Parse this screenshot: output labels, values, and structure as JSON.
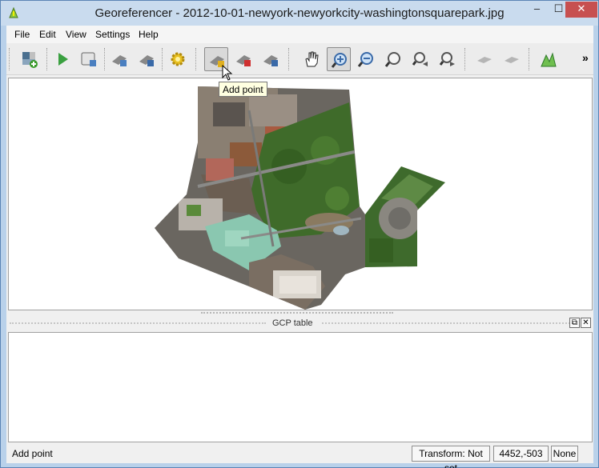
{
  "window": {
    "title": "Georeferencer - 2012-10-01-newyork-newyorkcity-washingtonsquarepark.jpg",
    "app_icon": "qgis-logo-icon",
    "minimize": "–",
    "maximize": "☐",
    "close": "✕"
  },
  "menubar": {
    "items": [
      {
        "label": "File"
      },
      {
        "label": "Edit"
      },
      {
        "label": "View"
      },
      {
        "label": "Settings"
      },
      {
        "label": "Help"
      }
    ]
  },
  "toolbar": {
    "buttons": [
      {
        "name": "open-raster-icon"
      },
      {
        "name": "start-georeferencing-icon"
      },
      {
        "name": "generate-gdal-script-icon"
      },
      {
        "name": "load-gcp-points-icon"
      },
      {
        "name": "save-gcp-points-icon"
      },
      {
        "name": "transformation-settings-icon"
      },
      {
        "name": "add-point-icon",
        "pressed": true
      },
      {
        "name": "delete-point-icon"
      },
      {
        "name": "move-gcp-point-icon"
      },
      {
        "name": "pan-icon"
      },
      {
        "name": "zoom-in-icon",
        "pressed": true
      },
      {
        "name": "zoom-out-icon"
      },
      {
        "name": "zoom-to-layer-icon"
      },
      {
        "name": "zoom-last-icon"
      },
      {
        "name": "zoom-next-icon"
      },
      {
        "name": "link-georeferencer-to-qgis-icon"
      },
      {
        "name": "link-qgis-to-georeferencer-icon"
      },
      {
        "name": "histogram-stretch-icon"
      }
    ],
    "overflow": "»"
  },
  "tooltip": {
    "text": "Add point"
  },
  "dock": {
    "title": "GCP table",
    "float_button": "⧉",
    "close_button": "✕"
  },
  "statusbar": {
    "message": "Add point",
    "transform": "Transform: Not set",
    "coordinates": "4452,-503",
    "none": "None"
  },
  "colors": {
    "title_bar": "#c9dbee",
    "close_button": "#c75050",
    "tooltip_bg": "#ffffe1",
    "park_green": "#3f6b2a",
    "roof_teal": "#8ac7b0"
  }
}
